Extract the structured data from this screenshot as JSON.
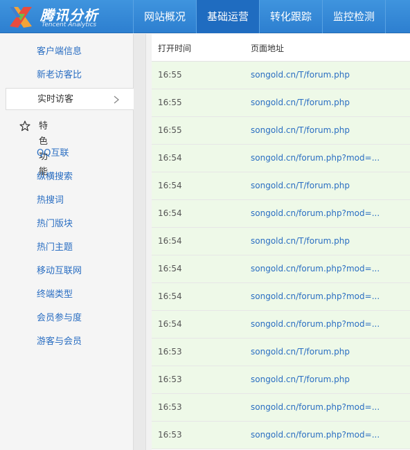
{
  "logo": {
    "title": "腾讯分析",
    "subtitle": "Tencent Analytics"
  },
  "nav": {
    "items": [
      {
        "label": "网站概况"
      },
      {
        "label": "基础运营"
      },
      {
        "label": "转化跟踪"
      },
      {
        "label": "监控检测"
      }
    ],
    "active": "基础运营"
  },
  "sidebar": {
    "top_items": [
      {
        "label": "客户端信息"
      },
      {
        "label": "新老访客比"
      }
    ],
    "active_item": {
      "label": "实时访客"
    },
    "feature_section": {
      "label": "特色功能"
    },
    "feature_items": [
      {
        "label": "QQ互联"
      },
      {
        "label": "纵横搜索"
      },
      {
        "label": "热搜词"
      },
      {
        "label": "热门版块"
      },
      {
        "label": "热门主题"
      },
      {
        "label": "移动互联网"
      },
      {
        "label": "终端类型"
      },
      {
        "label": "会员参与度"
      },
      {
        "label": "游客与会员"
      }
    ]
  },
  "table": {
    "headers": {
      "time": "打开时间",
      "url": "页面地址"
    },
    "rows": [
      {
        "time": "16:55",
        "url": "songold.cn/T/forum.php"
      },
      {
        "time": "16:55",
        "url": "songold.cn/T/forum.php"
      },
      {
        "time": "16:55",
        "url": "songold.cn/T/forum.php"
      },
      {
        "time": "16:54",
        "url": "songold.cn/forum.php?mod=..."
      },
      {
        "time": "16:54",
        "url": "songold.cn/T/forum.php"
      },
      {
        "time": "16:54",
        "url": "songold.cn/forum.php?mod=..."
      },
      {
        "time": "16:54",
        "url": "songold.cn/T/forum.php"
      },
      {
        "time": "16:54",
        "url": "songold.cn/forum.php?mod=..."
      },
      {
        "time": "16:54",
        "url": "songold.cn/forum.php?mod=..."
      },
      {
        "time": "16:54",
        "url": "songold.cn/forum.php?mod=..."
      },
      {
        "time": "16:53",
        "url": "songold.cn/T/forum.php"
      },
      {
        "time": "16:53",
        "url": "songold.cn/T/forum.php"
      },
      {
        "time": "16:53",
        "url": "songold.cn/forum.php?mod=..."
      },
      {
        "time": "16:53",
        "url": "songold.cn/forum.php?mod=..."
      }
    ]
  },
  "icons": {
    "logo": "tencent-analytics-logo-icon",
    "chevron": "chevron-right-icon",
    "star": "star-outline-icon"
  },
  "colors": {
    "header": "#3a8ddb",
    "nav_active": "#1f6cc0",
    "link": "#2a6ec2",
    "row_alt": "#eef9e8"
  }
}
